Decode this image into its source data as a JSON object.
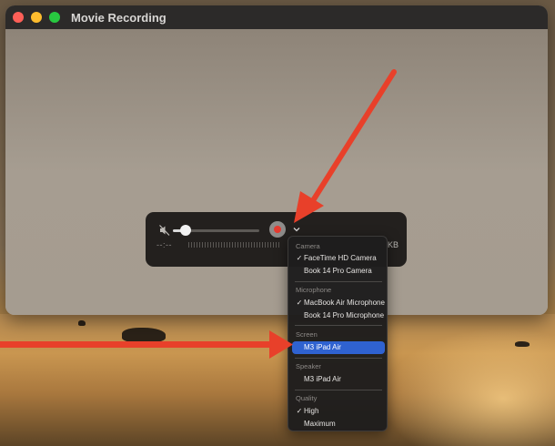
{
  "window": {
    "title": "Movie Recording"
  },
  "controls": {
    "time": "--:--",
    "file_size": "KB",
    "volume_fraction": 0.15
  },
  "menu": {
    "camera_header": "Camera",
    "camera_items": [
      {
        "label": "FaceTime HD Camera",
        "check": "✓"
      },
      {
        "label": "Book 14 Pro Camera",
        "check": ""
      }
    ],
    "microphone_header": "Microphone",
    "microphone_items": [
      {
        "label": "MacBook Air Microphone",
        "check": "✓"
      },
      {
        "label": "Book 14 Pro Microphone",
        "check": ""
      }
    ],
    "screen_header": "Screen",
    "screen_items": [
      {
        "label": "M3 iPad Air",
        "check": ""
      }
    ],
    "speaker_header": "Speaker",
    "speaker_items": [
      {
        "label": "M3 iPad Air",
        "check": ""
      }
    ],
    "quality_header": "Quality",
    "quality_items": [
      {
        "label": "High",
        "check": "✓"
      },
      {
        "label": "Maximum",
        "check": ""
      }
    ]
  },
  "colors": {
    "annotation_arrow": "#e8402a",
    "menu_selection": "#2f62d0",
    "record_red": "#e53a2f"
  },
  "icons": {
    "mute": "speaker-muted-icon",
    "record": "record-icon",
    "options": "chevron-down-icon"
  }
}
